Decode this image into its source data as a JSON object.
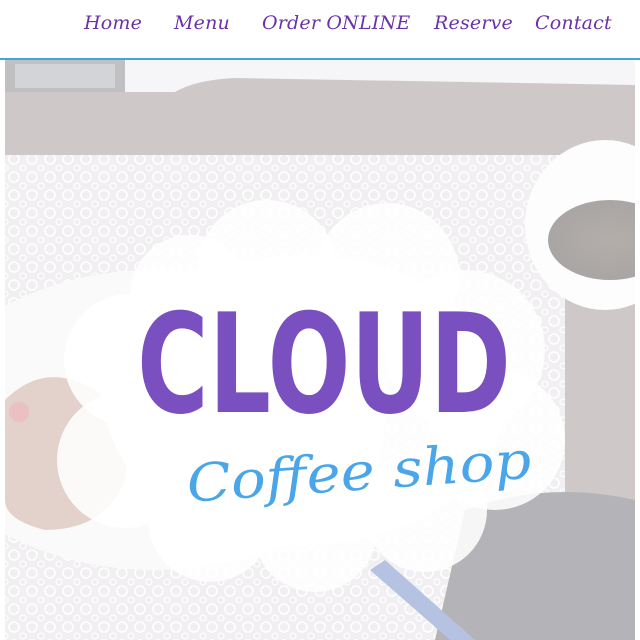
{
  "nav": {
    "items": [
      {
        "label": "Home"
      },
      {
        "label": "Menu"
      },
      {
        "label": "Order ONLINE"
      },
      {
        "label": "Reserve"
      },
      {
        "label": "Contact"
      }
    ]
  },
  "hero": {
    "logo_main": "CLOUD",
    "logo_sub": "Coffee shop"
  },
  "colors": {
    "nav_text": "#6a32a8",
    "nav_underline": "#3aa8df",
    "logo_main": "#7a4fbf",
    "logo_sub": "#4aa6e8",
    "cloud": "#ffffff"
  }
}
